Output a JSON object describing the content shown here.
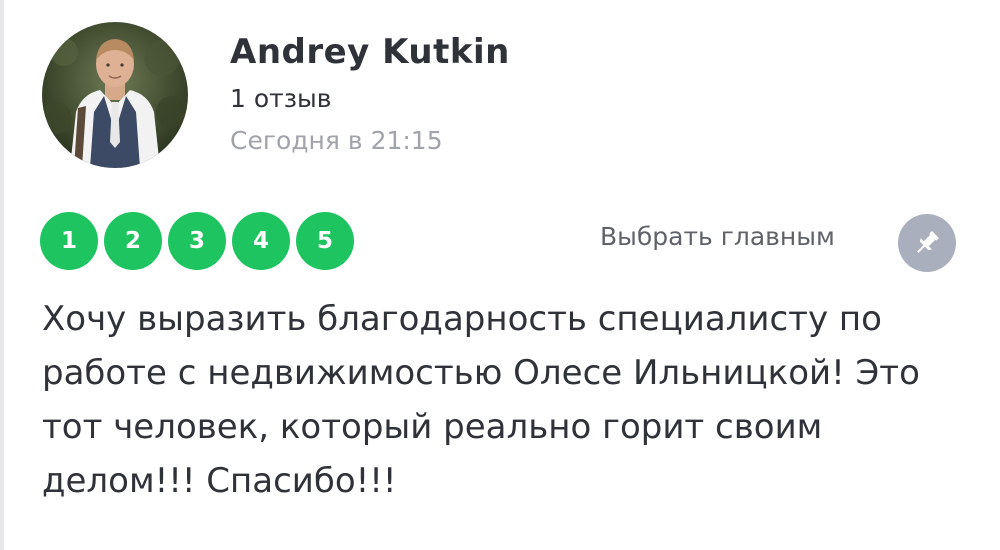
{
  "review": {
    "author": {
      "name": "Andrey Kutkin",
      "review_count": "1 отзыв",
      "date": "Сегодня в 21:15"
    },
    "rating": {
      "options": [
        "1",
        "2",
        "3",
        "4",
        "5"
      ],
      "color": "#1ec45f"
    },
    "make_main_label": "Выбрать главным",
    "pin_icon": "pin-icon",
    "text": "Хочу выразить благодарность специалисту по работе с недвижимостью Олесе Ильницкой! Это тот человек, который реально горит своим делом!!! Спасибо!!!"
  }
}
